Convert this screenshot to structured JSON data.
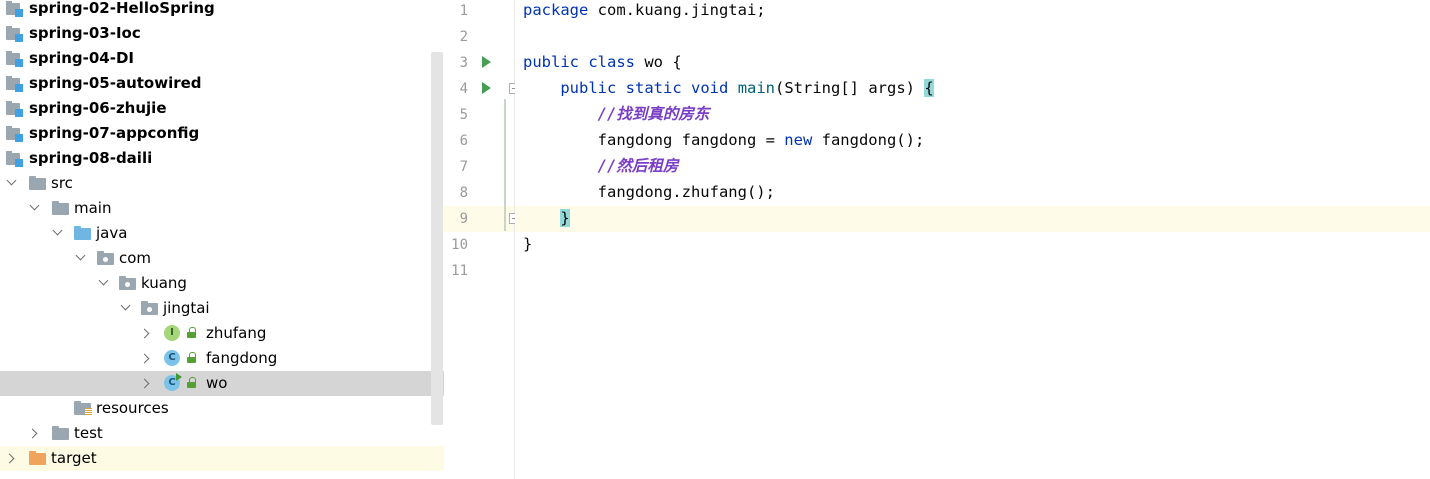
{
  "project_tree": {
    "modules": [
      "spring-02-HelloSpring",
      "spring-03-Ioc",
      "spring-04-DI",
      "spring-05-autowired",
      "spring-06-zhujie",
      "spring-07-appconfig",
      "spring-08-daili"
    ],
    "src": "src",
    "main": "main",
    "java": "java",
    "com": "com",
    "kuang": "kuang",
    "jingtai": "jingtai",
    "classes": [
      {
        "name": "zhufang",
        "badge": "I",
        "kind": "interface"
      },
      {
        "name": "fangdong",
        "badge": "C",
        "kind": "class"
      },
      {
        "name": "wo",
        "badge": "C",
        "kind": "class-runnable",
        "selected": true
      }
    ],
    "resources": "resources",
    "test": "test",
    "target": "target"
  },
  "editor": {
    "line_numbers": [
      "1",
      "2",
      "3",
      "4",
      "5",
      "6",
      "7",
      "8",
      "9",
      "10",
      "11"
    ],
    "lines": {
      "l1_kw": "package",
      "l1_rest": " com.kuang.jingtai;",
      "l3_kw1": "public",
      "l3_kw2": "class",
      "l3_rest": " wo {",
      "l4_kw1": "public",
      "l4_kw2": "static",
      "l4_kw3": "void",
      "l4_fn": "main",
      "l4_rest": "(String[] args) ",
      "l4_brace": "{",
      "l5_comment": "//找到真的房东",
      "l6_a": "fangdong fangdong = ",
      "l6_kw": "new",
      "l6_b": " fangdong();",
      "l7_comment": "//然后租房",
      "l8": "fangdong.zhufang();",
      "l9_brace": "}",
      "l10": "}"
    }
  },
  "colors": {
    "keyword": "#0033b3",
    "comment": "#7a3ec7",
    "current_line": "#fefbe8",
    "selection": "#d5d5d5",
    "run_marker": "#499c54"
  }
}
